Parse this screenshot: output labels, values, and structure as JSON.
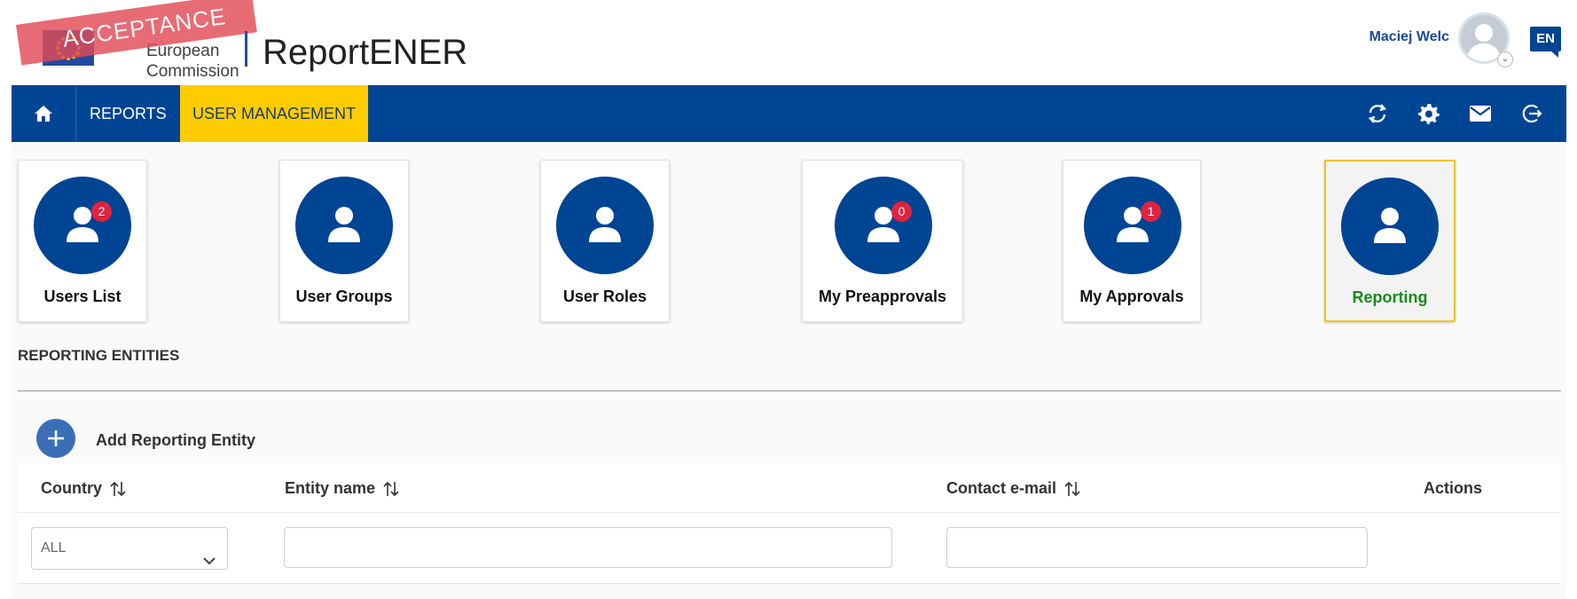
{
  "header": {
    "logo": {
      "org_line1": "European",
      "org_line2": "Commission",
      "watermark": "ACCEPTANCE"
    },
    "app_title": "ReportENER",
    "user_name": "Maciej Welc",
    "language": "EN"
  },
  "nav": {
    "items": [
      {
        "label": "REPORTS",
        "active": false
      },
      {
        "label": "USER MANAGEMENT",
        "active": true
      }
    ],
    "icons": [
      "home-icon",
      "refresh-icon",
      "settings-icon",
      "mail-icon",
      "logout-icon"
    ]
  },
  "tiles": [
    {
      "label": "Users List",
      "badge": "2",
      "active": false
    },
    {
      "label": "User Groups",
      "badge": null,
      "active": false
    },
    {
      "label": "User Roles",
      "badge": null,
      "active": false
    },
    {
      "label": "My Preapprovals",
      "badge": "0",
      "active": false
    },
    {
      "label": "My Approvals",
      "badge": "1",
      "active": false
    },
    {
      "label": "Reporting",
      "badge": null,
      "active": true
    }
  ],
  "section": {
    "title": "REPORTING ENTITIES",
    "add_label": "Add Reporting Entity"
  },
  "table": {
    "columns": [
      {
        "label": "Country",
        "sortable": true
      },
      {
        "label": "Entity name",
        "sortable": true
      },
      {
        "label": "Contact e-mail",
        "sortable": true
      },
      {
        "label": "Actions",
        "sortable": false
      }
    ],
    "filters": {
      "country": "ALL",
      "entity_name": "",
      "contact_email": ""
    }
  },
  "colors": {
    "primary": "#004494",
    "accent": "#ffcc00",
    "badge": "#e0233f",
    "active_label": "#178a1c"
  }
}
